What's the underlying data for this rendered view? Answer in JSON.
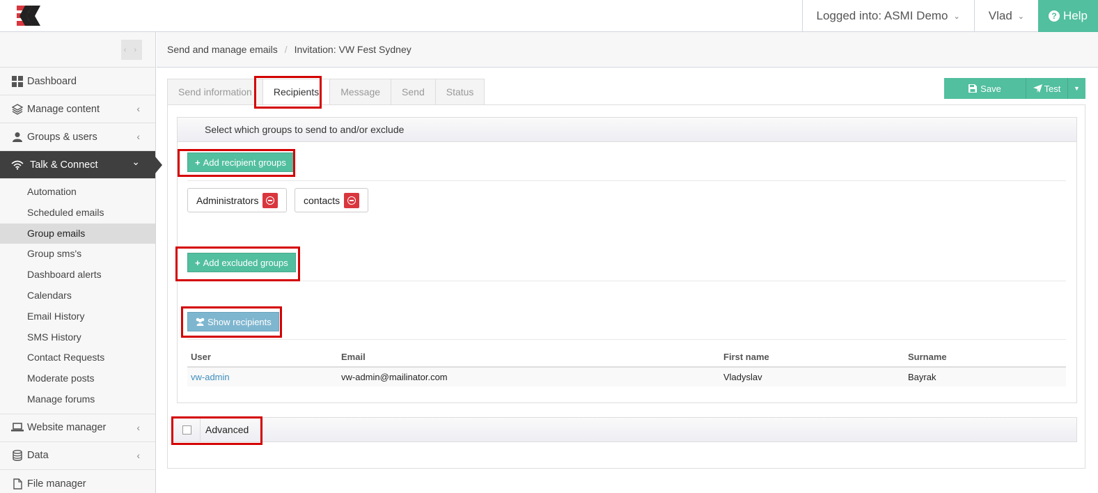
{
  "header": {
    "logged_into": "Logged into: ASMI Demo",
    "user": "Vlad",
    "help": "Help"
  },
  "sidebar": {
    "toggle_label": "‹ ›",
    "items": [
      {
        "label": "Dashboard",
        "icon": "dashboard-icon"
      },
      {
        "label": "Manage content",
        "icon": "layers-icon"
      },
      {
        "label": "Groups & users",
        "icon": "user-icon"
      },
      {
        "label": "Talk & Connect",
        "icon": "wifi-icon"
      }
    ],
    "sub_items": [
      "Automation",
      "Scheduled emails",
      "Group emails",
      "Group sms's",
      "Dashboard alerts",
      "Calendars",
      "Email History",
      "SMS History",
      "Contact Requests",
      "Moderate posts",
      "Manage forums"
    ],
    "current_sub": "Group emails",
    "bottom_items": [
      {
        "label": "Website manager",
        "icon": "laptop-icon"
      },
      {
        "label": "Data",
        "icon": "database-icon"
      },
      {
        "label": "File manager",
        "icon": "file-icon"
      }
    ]
  },
  "breadcrumb": {
    "parent": "Send and manage emails",
    "current": "Invitation: VW Fest Sydney"
  },
  "tabs": [
    "Send information",
    "Recipients",
    "Message",
    "Send",
    "Status"
  ],
  "active_tab": "Recipients",
  "actions": {
    "save": "Save",
    "test": "Test"
  },
  "recipients": {
    "heading": "Select which groups to send to and/or exclude",
    "add_groups": "Add recipient groups",
    "groups": [
      "Administrators",
      "contacts"
    ],
    "add_excluded": "Add excluded groups",
    "show_recipients": "Show recipients",
    "table": {
      "columns": [
        "User",
        "Email",
        "First name",
        "Surname"
      ],
      "rows": [
        [
          "vw-admin",
          "vw-admin@mailinator.com",
          "Vladyslav",
          "Bayrak"
        ]
      ]
    }
  },
  "advanced": {
    "label": "Advanced"
  },
  "colors": {
    "accent": "#52bf9f",
    "info": "#7fb6cf",
    "danger": "#d9363e",
    "highlight": "#d40000"
  }
}
